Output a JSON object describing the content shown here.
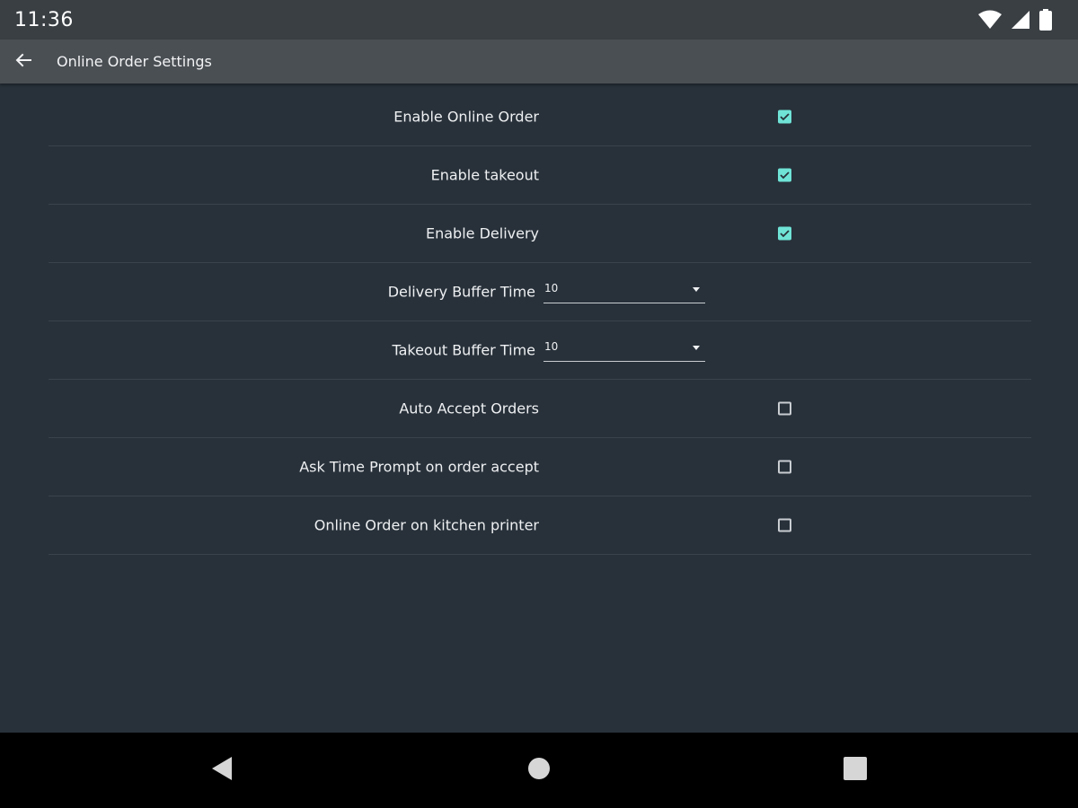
{
  "status_bar": {
    "time": "11:36",
    "icons": [
      "wifi-icon",
      "cell-signal-icon",
      "battery-icon"
    ]
  },
  "app_bar": {
    "title": "Online Order Settings",
    "back_icon": "arrow-left-icon"
  },
  "settings": [
    {
      "label": "Enable Online Order",
      "type": "checkbox",
      "checked": true
    },
    {
      "label": "Enable takeout",
      "type": "checkbox",
      "checked": true
    },
    {
      "label": "Enable Delivery",
      "type": "checkbox",
      "checked": true
    },
    {
      "label": "Delivery Buffer Time",
      "type": "dropdown",
      "value": "10"
    },
    {
      "label": "Takeout Buffer Time",
      "type": "dropdown",
      "value": "10"
    },
    {
      "label": "Auto Accept Orders",
      "type": "checkbox",
      "checked": false
    },
    {
      "label": "Ask Time Prompt on order accept",
      "type": "checkbox",
      "checked": false
    },
    {
      "label": "Online Order on kitchen printer",
      "type": "checkbox",
      "checked": false
    }
  ],
  "nav_bar": {
    "icons": [
      "nav-back-icon",
      "nav-home-icon",
      "nav-recents-icon"
    ]
  },
  "colors": {
    "background": "#28313a",
    "app_bar": "#4a4f54",
    "status_bar": "#3a3f44",
    "accent": "#6fe3d6",
    "divider": "#3a434c"
  }
}
